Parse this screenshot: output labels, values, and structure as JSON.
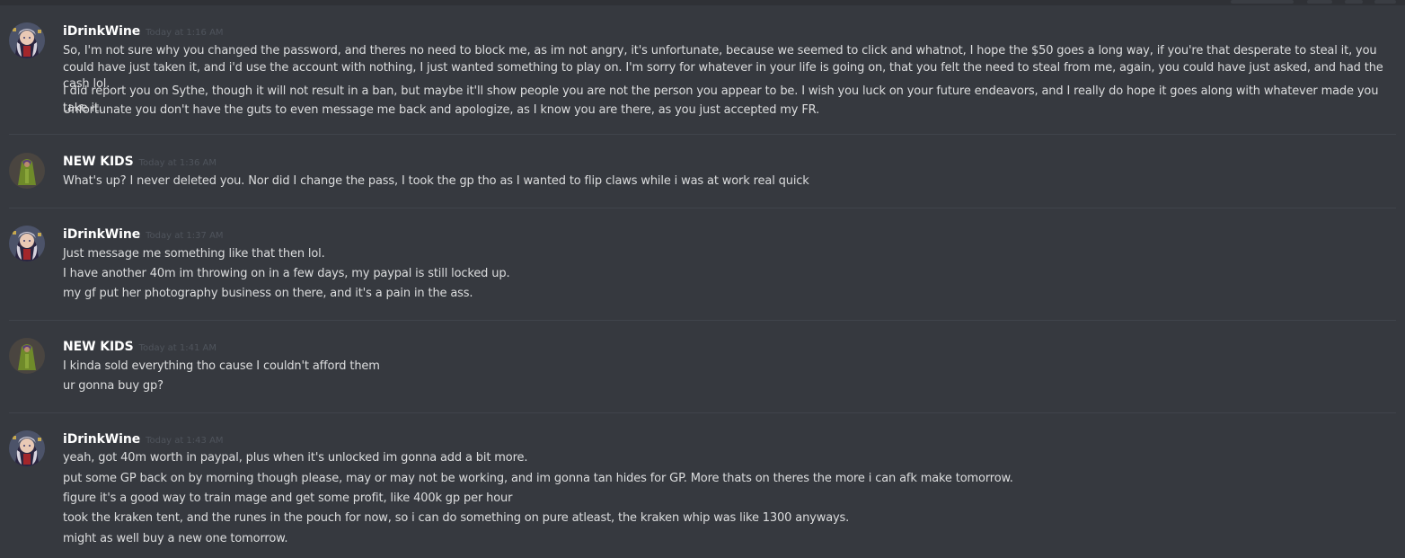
{
  "messages": [
    {
      "author": "iDrinkWine",
      "avatar": "anime-character-avatar",
      "timestamp": "Today at 1:16 AM",
      "lines": [
        "So, I'm not sure why you changed the password, and theres no need to block me, as im not angry, it's unfortunate, because we seemed to click and whatnot, I hope the $50 goes a long way, if you're that desperate to steal it, you could have just taken it, and i'd use the account with nothing, I just wanted something to play on. I'm sorry for whatever in your life is going on, that you felt the need to steal from me, again, you could have just asked, and had the cash lol.",
        "I did report you on Sythe, though it will not result in a ban, but maybe it'll show people you are not the person you appear to be. I wish you luck on your future endeavors, and I really do hope it goes along with whatever made you take it.",
        "Unfortunate you don't have the guts to even message me back and apologize, as I know you are there, as you just accepted my FR."
      ]
    },
    {
      "author": "NEW KIDS",
      "avatar": "game-character-avatar",
      "timestamp": "Today at 1:36 AM",
      "lines": [
        "What's up? I never deleted you. Nor did I change the pass, I took the gp tho as I wanted to flip claws while i was at work real quick"
      ]
    },
    {
      "author": "iDrinkWine",
      "avatar": "anime-character-avatar",
      "timestamp": "Today at 1:37 AM",
      "lines": [
        "Just message me something like that then lol.",
        "I have another 40m im throwing on in a few days, my paypal is still locked up.",
        "my gf put her photography business on there, and it's a pain in the ass."
      ]
    },
    {
      "author": "NEW KIDS",
      "avatar": "game-character-avatar",
      "timestamp": "Today at 1:41 AM",
      "lines": [
        "I kinda sold everything tho cause I couldn't afford them",
        "ur gonna buy gp?"
      ]
    },
    {
      "author": "iDrinkWine",
      "avatar": "anime-character-avatar",
      "timestamp": "Today at 1:43 AM",
      "lines": [
        "yeah, got 40m worth in paypal, plus when it's unlocked im gonna add a bit more.",
        "put some GP back on by morning though please, may or may not be working, and im gonna tan hides for GP. More thats on theres the more i can afk make tomorrow.",
        "figure it's a good way to train mage and get some profit, like 400k gp per hour",
        "took the kraken tent, and the runes in the pouch for now, so i can do something on pure atleast, the kraken whip was like 1300 anyways.",
        "might as well buy a new one tomorrow."
      ]
    }
  ],
  "colors": {
    "background": "#36393f",
    "username": "#ffffff",
    "timestamp": "#4f545c",
    "text": "#dcddde",
    "divider": "#40444b"
  }
}
